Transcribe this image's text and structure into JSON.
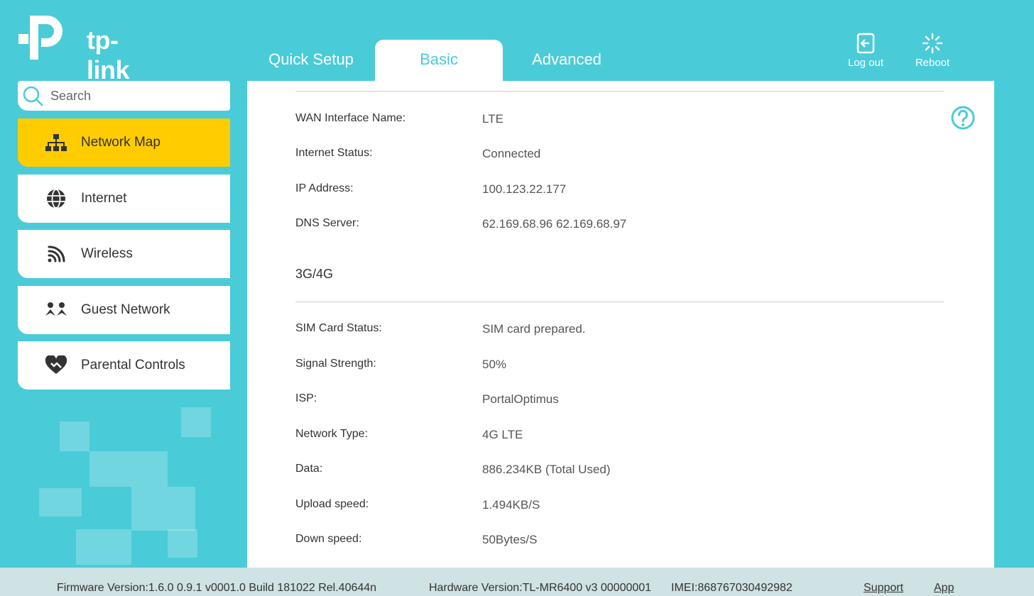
{
  "brand": {
    "logo_text": "tp-link"
  },
  "tabs": [
    {
      "label": "Quick Setup"
    },
    {
      "label": "Basic"
    },
    {
      "label": "Advanced"
    }
  ],
  "top_actions": {
    "logout_label": "Log out",
    "reboot_label": "Reboot"
  },
  "search": {
    "placeholder": "Search"
  },
  "sidebar": {
    "items": [
      {
        "label": "Network Map",
        "icon": "network-map-icon"
      },
      {
        "label": "Internet",
        "icon": "globe-icon"
      },
      {
        "label": "Wireless",
        "icon": "wifi-icon"
      },
      {
        "label": "Guest Network",
        "icon": "guest-icon"
      },
      {
        "label": "Parental Controls",
        "icon": "heart-icon"
      }
    ]
  },
  "wan": {
    "rows": [
      {
        "label": "WAN Interface Name:",
        "value": "LTE"
      },
      {
        "label": "Internet Status:",
        "value": "Connected"
      },
      {
        "label": "IP Address:",
        "value": "100.123.22.177"
      },
      {
        "label": "DNS Server:",
        "value": "62.169.68.96 62.169.68.97"
      }
    ]
  },
  "mobile": {
    "title": "3G/4G",
    "rows": [
      {
        "label": "SIM Card Status:",
        "value": "SIM card prepared."
      },
      {
        "label": "Signal Strength:",
        "value": "50%"
      },
      {
        "label": "ISP:",
        "value": "PortalOptimus"
      },
      {
        "label": "Network Type:",
        "value": "4G LTE"
      },
      {
        "label": "Data:",
        "value": "886.234KB (Total Used)"
      },
      {
        "label": "Upload speed:",
        "value": "1.494KB/S"
      },
      {
        "label": "Down speed:",
        "value": "50Bytes/S"
      }
    ]
  },
  "footer": {
    "firmware": "Firmware Version:1.6.0 0.9.1 v0001.0 Build 181022 Rel.40644n",
    "hardware": "Hardware Version:TL-MR6400 v3 00000001",
    "imei": "IMEI:868767030492982",
    "support_label": "Support",
    "app_label": "App"
  },
  "colors": {
    "background": "#4acbd8",
    "active_nav": "#ffcc00",
    "accent": "#4acbd8"
  }
}
